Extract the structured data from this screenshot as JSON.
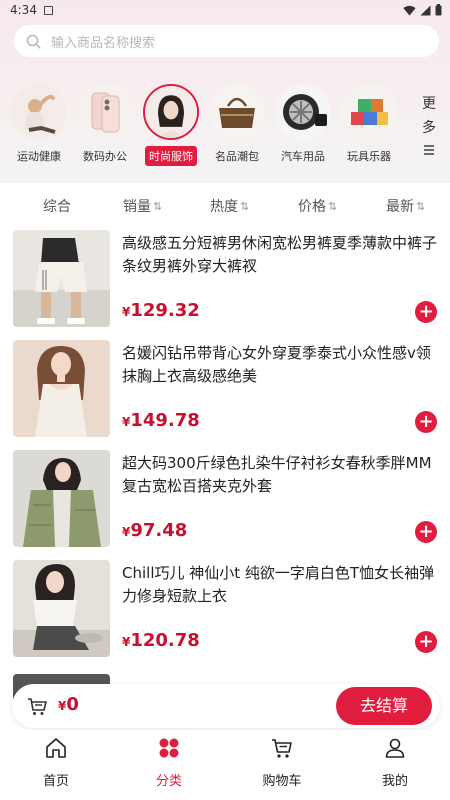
{
  "status_bar": {
    "time": "4:34"
  },
  "search": {
    "placeholder": "输入商品名称搜索"
  },
  "categories": [
    {
      "label": "运动健康",
      "icon": "yoga-woman-photo"
    },
    {
      "label": "数码办公",
      "icon": "smartphone-photo"
    },
    {
      "label": "时尚服饰",
      "icon": "fashion-woman-photo",
      "active": true
    },
    {
      "label": "名品潮包",
      "icon": "handbag-photo"
    },
    {
      "label": "汽车用品",
      "icon": "car-wheel-photo"
    },
    {
      "label": "玩具乐器",
      "icon": "toy-blocks-photo"
    }
  ],
  "more_label": "更多",
  "sort": {
    "overall": "综合",
    "sales": "销量",
    "popularity": "热度",
    "price": "价格",
    "newest": "最新",
    "sort_icon": "⇅"
  },
  "products": [
    {
      "title": "高级感五分短裤男休闲宽松男裤夏季薄款中裤子条纹男裤外穿大裤衩",
      "currency": "¥",
      "price": "129.32"
    },
    {
      "title": "名媛闪钻吊带背心女外穿夏季泰式小众性感v领抹胸上衣高级感绝美",
      "currency": "¥",
      "price": "149.78"
    },
    {
      "title": "超大码300斤绿色扎染牛仔衬衫女春秋季胖MM复古宽松百搭夹克外套",
      "currency": "¥",
      "price": "97.48"
    },
    {
      "title": "Chill巧儿 神仙小t 纯欲一字肩白色T恤女长袖弹力修身短款上衣",
      "currency": "¥",
      "price": "120.78"
    }
  ],
  "cart_bar": {
    "currency": "¥",
    "amount": "0",
    "checkout_label": "去结算"
  },
  "tabs": [
    {
      "label": "首页",
      "icon": "home-icon"
    },
    {
      "label": "分类",
      "icon": "category-icon",
      "active": true
    },
    {
      "label": "购物车",
      "icon": "cart-icon"
    },
    {
      "label": "我的",
      "icon": "profile-icon"
    }
  ],
  "colors": {
    "accent": "#e01d3f",
    "price": "#c8102e"
  }
}
